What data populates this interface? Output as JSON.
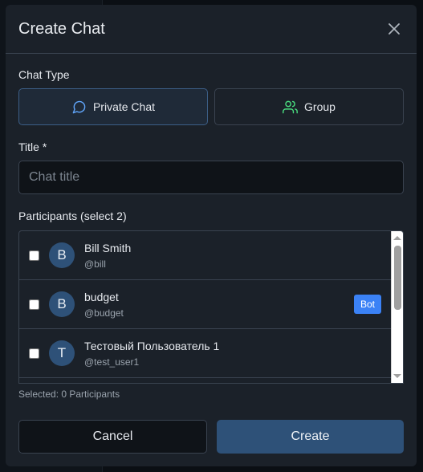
{
  "modal": {
    "title": "Create Chat",
    "close_icon": "close-icon"
  },
  "chat_type": {
    "label": "Chat Type",
    "options": [
      {
        "label": "Private Chat",
        "icon": "message-circle-icon",
        "active": true
      },
      {
        "label": "Group",
        "icon": "users-icon",
        "active": false
      }
    ]
  },
  "title_field": {
    "label": "Title *",
    "placeholder": "Chat title",
    "value": ""
  },
  "participants": {
    "label": "Participants (select 2)",
    "items": [
      {
        "initial": "B",
        "name": "Bill Smith",
        "handle": "@bill",
        "badge": ""
      },
      {
        "initial": "B",
        "name": "budget",
        "handle": "@budget",
        "badge": "Bot"
      },
      {
        "initial": "T",
        "name": "Тестовый Пользователь 1",
        "handle": "@test_user1",
        "badge": ""
      }
    ],
    "selected_text": "Selected: 0 Participants"
  },
  "footer": {
    "cancel_label": "Cancel",
    "create_label": "Create"
  },
  "colors": {
    "accent": "#2e5178",
    "bot_badge": "#3b82f6",
    "group_icon": "#4ade80",
    "private_icon": "#60a5fa"
  }
}
